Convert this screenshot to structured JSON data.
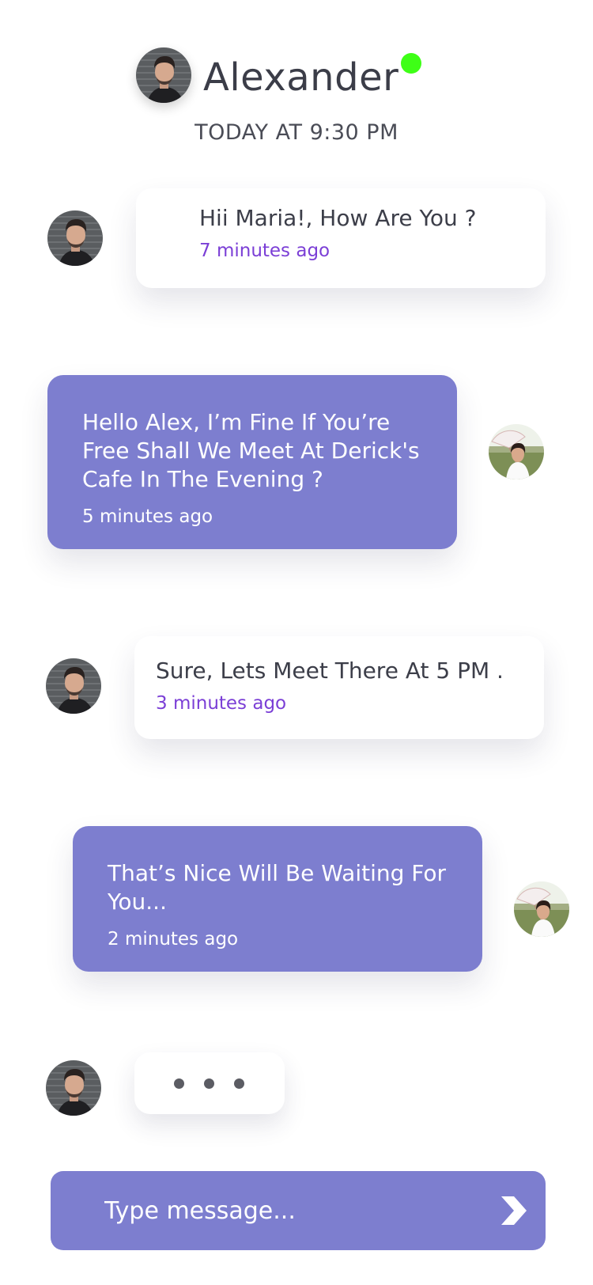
{
  "header": {
    "contact_name": "Alexander",
    "online_status": "online",
    "date_label": "TODAY AT 9:30 PM"
  },
  "messages": [
    {
      "sender": "Alexander",
      "direction": "incoming",
      "text": "Hii Maria!, How Are You ?",
      "time": "7 minutes ago"
    },
    {
      "sender": "Maria",
      "direction": "outgoing",
      "text": "Hello Alex, I’m Fine If You’re Free Shall We Meet At Derick's Cafe In The Evening ?",
      "time": "5 minutes ago"
    },
    {
      "sender": "Alexander",
      "direction": "incoming",
      "text": "Sure, Lets Meet There At 5 PM .",
      "time": "3 minutes ago"
    },
    {
      "sender": "Maria",
      "direction": "outgoing",
      "text": "That’s Nice Will Be Waiting For You...",
      "time": "2 minutes ago"
    }
  ],
  "typing_indicator": {
    "sender": "Alexander"
  },
  "composer": {
    "placeholder": "Type message..."
  },
  "colors": {
    "accent": "#7d7ecf",
    "online": "#3eff16",
    "time_incoming": "#7b3fd6",
    "text": "#3c3e49",
    "background": "#ffffff"
  },
  "icons": {
    "send": "send-chevron-icon",
    "online": "online-dot"
  }
}
